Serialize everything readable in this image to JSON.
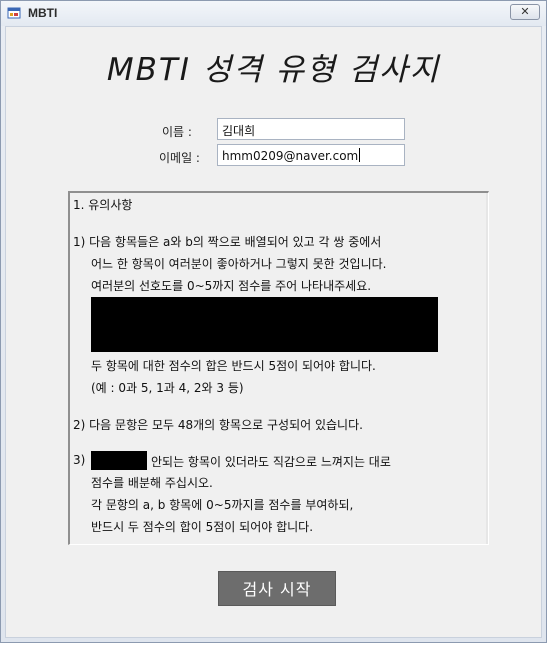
{
  "window": {
    "title": "MBTI",
    "close_glyph": "✕"
  },
  "header": {
    "title": "MBTI 성격 유형 검사지"
  },
  "form": {
    "name_label": "이름 :",
    "name_value": "김대희",
    "email_label": "이메일 :",
    "email_value": "hmm0209@naver.com"
  },
  "notes": {
    "heading": "1. 유의사항",
    "p1_line1": "1) 다음 항목들은 a와 b의 짝으로 배열되어 있고 각 쌍 중에서",
    "p1_line2": "어느 한 항목이 여러분이 좋아하거나 그렇지 못한 것입니다.",
    "p1_line3": "여러분의 선호도를 0~5까지 점수를 주어 나타내주세요.",
    "p1_line4": "두 항목에 대한 점수의 합은 반드시 5점이 되어야 합니다.",
    "p1_line5": "(예 : 0과 5, 1과 4, 2와 3 등)",
    "p2": "2) 다음 문항은 모두 48개의 항목으로 구성되어 있습니다.",
    "p3_prefix": "3)",
    "p3_line1_rest": "안되는 항목이 있더라도 직감으로 느껴지는 대로",
    "p3_line2": "점수를 배분해 주십시오.",
    "p3_line3": "각 문항의 a, b 항목에 0~5까지를 점수를 부여하되,",
    "p3_line4": "반드시 두 점수의 합이 5점이 되어야 합니다."
  },
  "actions": {
    "start_label": "검사 시작"
  },
  "icons": {
    "app_icon": "app-window-icon",
    "close_icon": "close-icon"
  }
}
